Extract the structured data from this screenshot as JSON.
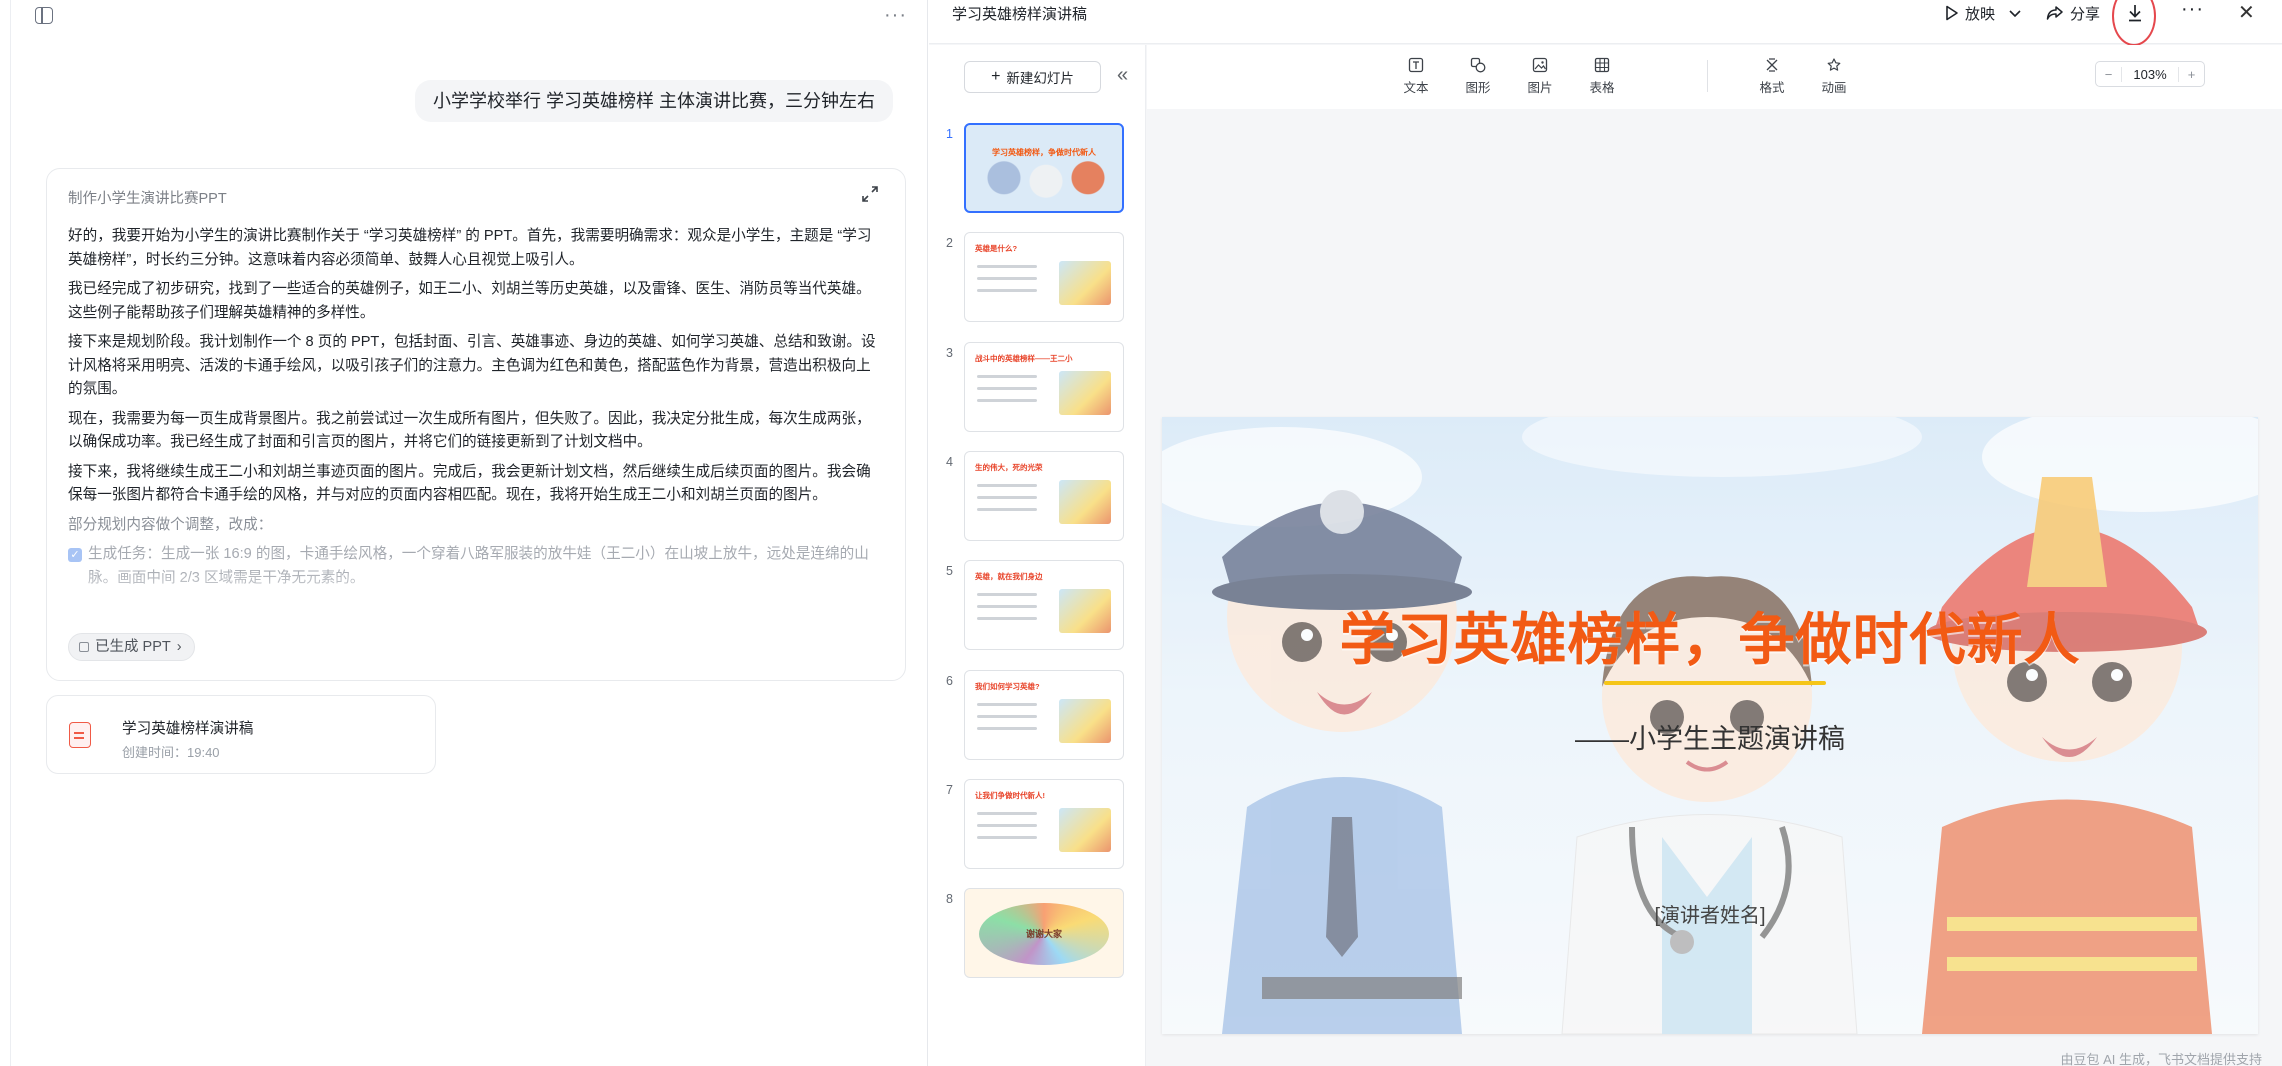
{
  "chat": {
    "user_message": "小学学校举行 学习英雄榜样 主体演讲比赛，三分钟左右",
    "task_card": {
      "title": "制作小学生演讲比赛PPT",
      "paragraphs": [
        "好的，我要开始为小学生的演讲比赛制作关于 “学习英雄榜样” 的 PPT。首先，我需要明确需求：观众是小学生，主题是 “学习英雄榜样”，时长约三分钟。这意味着内容必须简单、鼓舞人心且视觉上吸引人。",
        "我已经完成了初步研究，找到了一些适合的英雄例子，如王二小、刘胡兰等历史英雄，以及雷锋、医生、消防员等当代英雄。这些例子能帮助孩子们理解英雄精神的多样性。",
        "接下来是规划阶段。我计划制作一个 8 页的 PPT，包括封面、引言、英雄事迹、身边的英雄、如何学习英雄、总结和致谢。设计风格将采用明亮、活泼的卡通手绘风，以吸引孩子们的注意力。主色调为红色和黄色，搭配蓝色作为背景，营造出积极向上的氛围。",
        "现在，我需要为每一页生成背景图片。我之前尝试过一次生成所有图片，但失败了。因此，我决定分批生成，每次生成两张，以确保成功率。我已经生成了封面和引言页的图片，并将它们的链接更新到了计划文档中。",
        "接下来，我将继续生成王二小和刘胡兰事迹页面的图片。完成后，我会更新计划文档，然后继续生成后续页面的图片。我会确保每一张图片都符合卡通手绘的风格，并与对应的页面内容相匹配。现在，我将开始生成王二小和刘胡兰页面的图片。"
      ],
      "adjust_note": "部分规划内容做个调整，改成：",
      "subtask": "生成任务：生成一张 16:9 的图，卡通手绘风格，一个穿着八路军服装的放牛娃（王二小）在山坡上放牛，远处是连绵的山脉。画面中间 2/3 区域需是干净无元素的。",
      "generated_chip": "已生成 PPT"
    },
    "file_card": {
      "name": "学习英雄榜样演讲稿",
      "created": "创建时间：19:40"
    }
  },
  "ppt": {
    "doc_title": "学习英雄榜样演讲稿",
    "header": {
      "play_label": "放映",
      "share_label": "分享"
    },
    "new_slide_label": "新建幻灯片",
    "toolbar": {
      "text": "文本",
      "shape": "图形",
      "image": "图片",
      "table": "表格",
      "format": "格式",
      "animation": "动画",
      "zoom": "103%",
      "zoom_minus": "−",
      "zoom_plus": "+"
    },
    "thumbnails": [
      {
        "num": "1",
        "title": "学习英雄榜样，争做时代新人"
      },
      {
        "num": "2",
        "title": "英雄是什么?"
      },
      {
        "num": "3",
        "title": "战斗中的英雄榜样——王二小"
      },
      {
        "num": "4",
        "title": "生的伟大，死的光荣"
      },
      {
        "num": "5",
        "title": "英雄，就在我们身边"
      },
      {
        "num": "6",
        "title": "我们如何学习英雄?"
      },
      {
        "num": "7",
        "title": "让我们争做时代新人!"
      },
      {
        "num": "8",
        "title": "谢谢大家"
      }
    ],
    "slide": {
      "title": "学习英雄榜样，争做时代新人",
      "subtitle": "——小学生主题演讲稿",
      "speaker": "[演讲者姓名]"
    },
    "footer_note": "由豆包 AI 生成，飞书文档提供支持",
    "colors": {
      "accent": "#3370ff",
      "title_orange": "#f25a14",
      "highlight_red": "#e5484d"
    }
  }
}
